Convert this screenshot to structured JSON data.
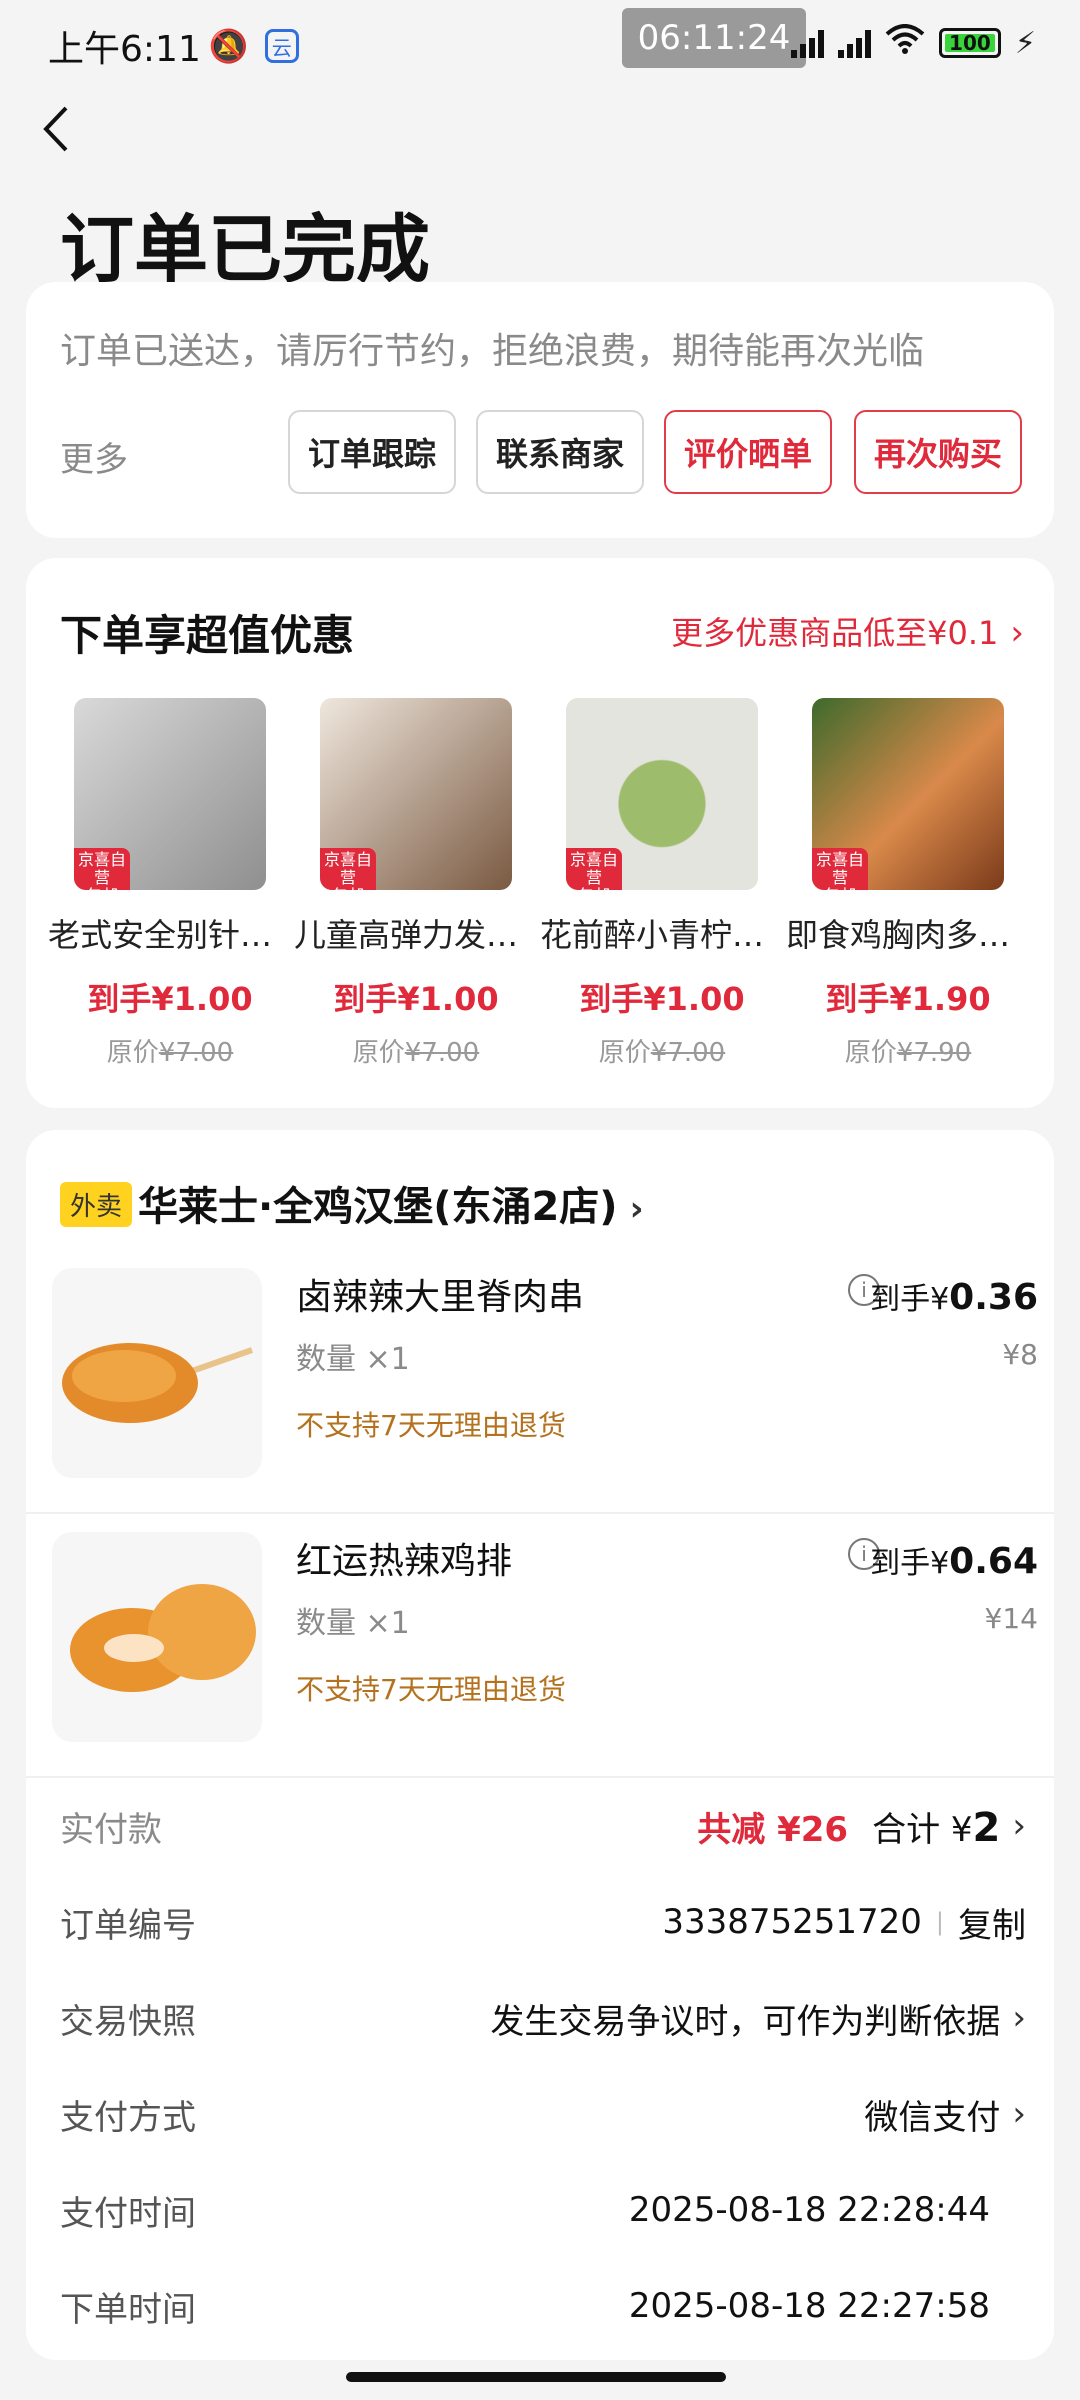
{
  "status_bar": {
    "time": "上午6:11",
    "clock_overlay": "06:11:24",
    "battery": "100"
  },
  "header": {
    "title": "订单已完成"
  },
  "status_card": {
    "note": "订单已送达，请厉行节约，拒绝浪费，期待能再次光临",
    "more_label": "更多",
    "buttons": [
      "订单跟踪",
      "联系商家",
      "评价晒单",
      "再次购买"
    ]
  },
  "promo": {
    "title": "下单享超值优惠",
    "more_link": "更多优惠商品低至¥0.1",
    "tag_line1": "京喜自营",
    "tag_line2": "包邮",
    "price_prefix": "原价",
    "products": [
      {
        "name": "老式安全别针…",
        "price": "到手¥1.00",
        "original": "¥7.00",
        "color": "#9c9c9c"
      },
      {
        "name": "儿童高弹力发…",
        "price": "到手¥1.00",
        "original": "¥7.00",
        "color": "#b89a7a"
      },
      {
        "name": "花前醉小青柠…",
        "price": "到手¥1.00",
        "original": "¥7.00",
        "color": "#8aa86a"
      },
      {
        "name": "即食鸡胸肉多…",
        "price": "到手¥1.90",
        "original": "¥7.90",
        "color": "#c0602a"
      }
    ]
  },
  "order": {
    "badge": "外卖",
    "shop": "华莱士·全鸡汉堡(东涌2店)",
    "items": [
      {
        "title": "卤辣辣大里脊肉串",
        "qty": "数量 ×1",
        "policy": "不支持7天无理由退货",
        "deal_prefix": "到手¥",
        "deal_value": "0.36",
        "original": "¥8"
      },
      {
        "title": "红运热辣鸡排",
        "qty": "数量 ×1",
        "policy": "不支持7天无理由退货",
        "deal_prefix": "到手¥",
        "deal_value": "0.64",
        "original": "¥14"
      }
    ],
    "paid_label": "实付款",
    "savings": "共减 ¥26",
    "total_prefix": "合计 ¥",
    "total_value": "2",
    "order_no_label": "订单编号",
    "order_no": "333875251720",
    "copy": "复制",
    "snapshot_label": "交易快照",
    "snapshot_value": "发生交易争议时，可作为判断依据",
    "pay_method_label": "支付方式",
    "pay_method": "微信支付",
    "pay_time_label": "支付时间",
    "pay_time": "2025-08-18 22:28:44",
    "order_time_label": "下单时间",
    "order_time": "2025-08-18 22:27:58"
  },
  "colors": {
    "accent_red": "#e0293a",
    "badge_yellow": "#ffd21f",
    "policy_orange": "#b4721e"
  }
}
